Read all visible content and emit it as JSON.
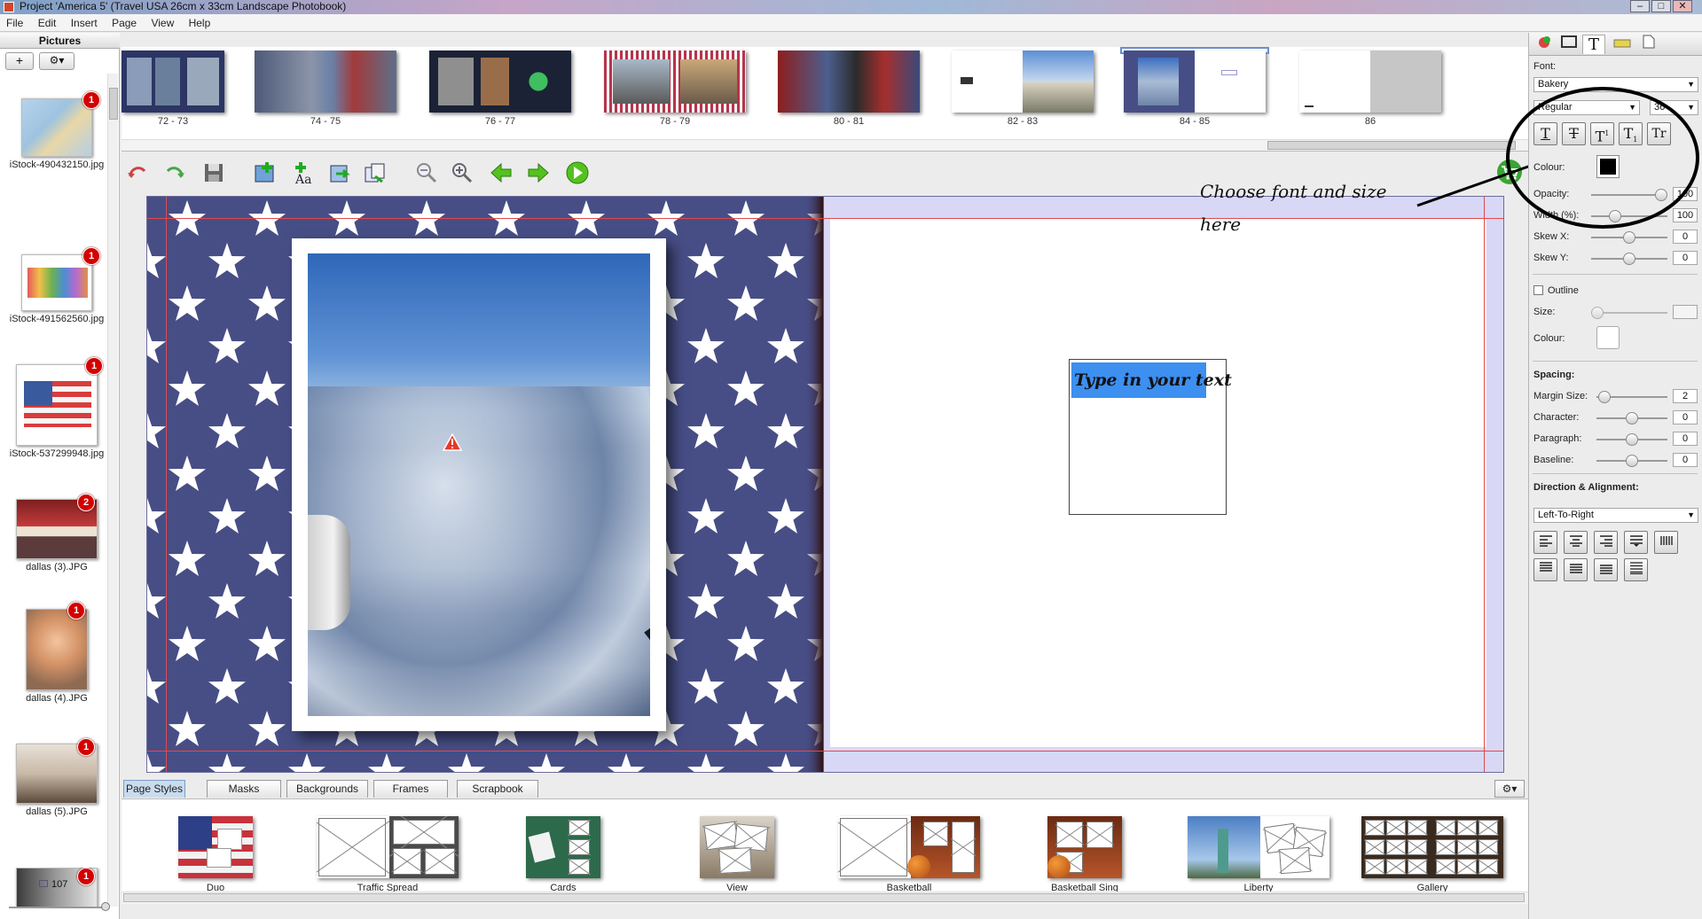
{
  "window": {
    "title": "Project 'America 5' (Travel USA 26cm x 33cm Landscape Photobook)",
    "controls": [
      "–",
      "□",
      "✕"
    ]
  },
  "menu": [
    "File",
    "Edit",
    "Insert",
    "Page",
    "View",
    "Help"
  ],
  "pictures_panel": {
    "heading": "Pictures",
    "add_label": "+",
    "gear_label": "⚙▾",
    "count": "107",
    "items": [
      {
        "name": "iStock-490432150.jpg",
        "badge": "1"
      },
      {
        "name": "iStock-491562560.jpg",
        "badge": "1"
      },
      {
        "name": "iStock-537299948.jpg",
        "badge": "1"
      },
      {
        "name": "dallas (3).JPG",
        "badge": "2"
      },
      {
        "name": "dallas (4).JPG",
        "badge": "1"
      },
      {
        "name": "dallas (5).JPG",
        "badge": "1"
      },
      {
        "name": "",
        "badge": "1"
      }
    ]
  },
  "spreads": [
    {
      "label": "72 - 73"
    },
    {
      "label": "74 - 75"
    },
    {
      "label": "76 - 77"
    },
    {
      "label": "78 - 79"
    },
    {
      "label": "80 - 81"
    },
    {
      "label": "82 - 83"
    },
    {
      "label": "84 - 85"
    },
    {
      "label": "86"
    }
  ],
  "canvas": {
    "textbox_text": "Type in your text"
  },
  "annotation": {
    "line1": "Choose font and size",
    "line2": "here"
  },
  "text_panel": {
    "font_label": "Font:",
    "font_value": "Bakery",
    "style_value": "Regular",
    "size_value": "36",
    "format_buttons": [
      "T",
      "T",
      "T",
      "T",
      "Tr"
    ],
    "colour_label": "Colour:",
    "text_colour": "#000000",
    "opacity_label": "Opacity:",
    "opacity_value": "100",
    "width_label": "Width (%):",
    "width_value": "100",
    "skewx_label": "Skew X:",
    "skewx_value": "0",
    "skewy_label": "Skew Y:",
    "skewy_value": "0",
    "outline_label": "Outline",
    "outline_size_label": "Size:",
    "outline_colour_label": "Colour:",
    "spacing_label": "Spacing:",
    "margin_label": "Margin Size:",
    "margin_value": "2",
    "character_label": "Character:",
    "character_value": "0",
    "paragraph_label": "Paragraph:",
    "paragraph_value": "0",
    "baseline_label": "Baseline:",
    "baseline_value": "0",
    "direction_label": "Direction & Alignment:",
    "direction_value": "Left-To-Right"
  },
  "bottom_tabs": [
    "Page Styles",
    "Masks",
    "Backgrounds",
    "Frames",
    "Scrapbook"
  ],
  "styles": [
    {
      "label": "Duo"
    },
    {
      "label": "Traffic Spread"
    },
    {
      "label": "Cards"
    },
    {
      "label": "View"
    },
    {
      "label": "Basketball"
    },
    {
      "label": "Basketball Sing"
    },
    {
      "label": "Liberty"
    },
    {
      "label": "Gallery"
    }
  ],
  "colors": {
    "accent": "#3d8ff0",
    "star_bg": "#474e86",
    "badge": "#d40000"
  }
}
